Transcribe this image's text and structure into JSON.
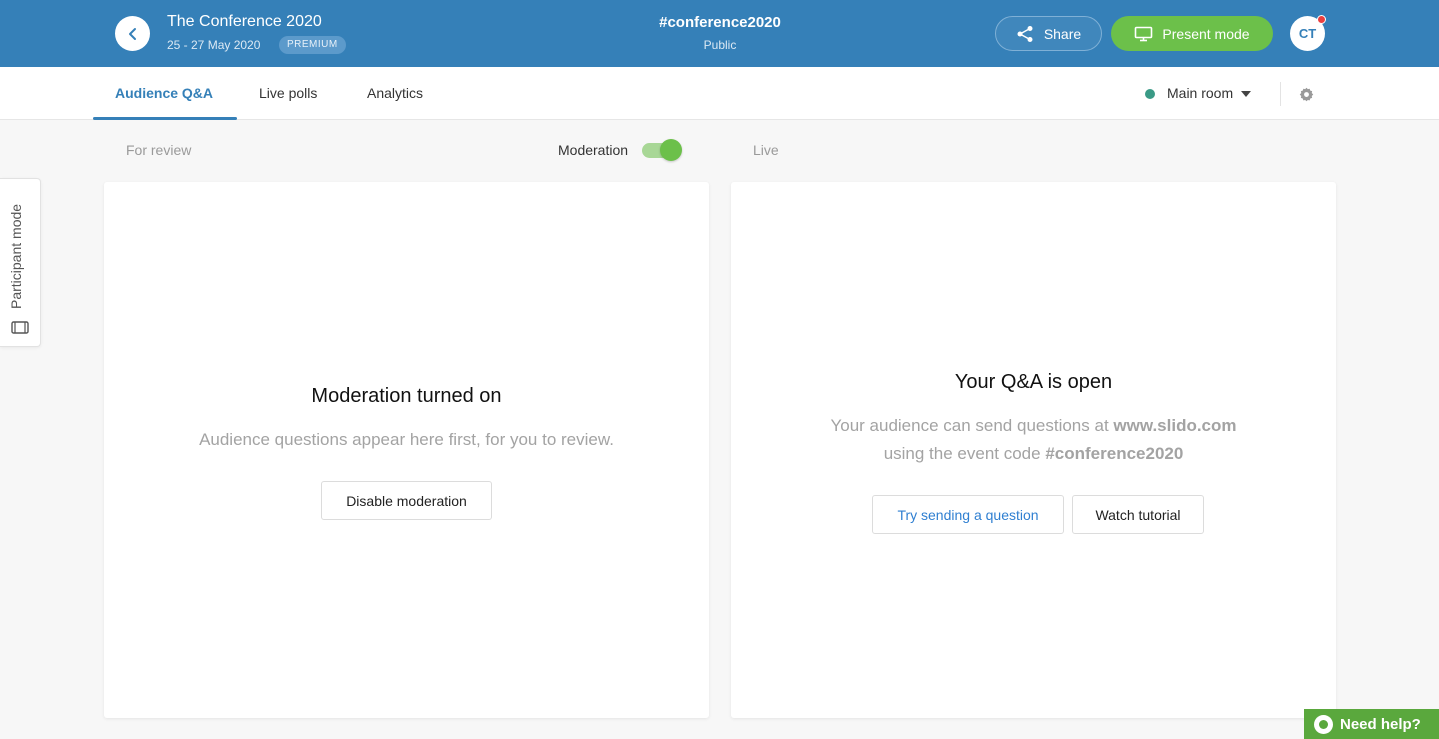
{
  "header": {
    "event_title": "The Conference 2020",
    "event_dates": "25 - 27 May 2020",
    "badge": "PREMIUM",
    "event_code": "#conference2020",
    "privacy": "Public",
    "share_label": "Share",
    "present_label": "Present mode",
    "avatar_initials": "CT",
    "colors": {
      "bar": "#3580b8",
      "present": "#6cc04a"
    },
    "icons": [
      "chevron-left-icon",
      "share-icon",
      "presentation-icon",
      "notification-dot"
    ]
  },
  "tabs": {
    "items": [
      {
        "label": "Audience Q&A",
        "active": true
      },
      {
        "label": "Live polls",
        "active": false
      },
      {
        "label": "Analytics",
        "active": false
      }
    ],
    "room_label": "Main room",
    "room_status_color": "#3a9a86",
    "icons": [
      "caret-down-icon",
      "gear-icon"
    ]
  },
  "columns": {
    "for_review": "For review",
    "moderation": "Moderation",
    "moderation_on": true,
    "live": "Live"
  },
  "left_card": {
    "title": "Moderation turned on",
    "text": "Audience questions appear here first, for you to review.",
    "button": "Disable moderation"
  },
  "right_card": {
    "title": "Your Q&A is open",
    "line1_prefix": "Your audience can send questions at",
    "line1_bold": "www.slido.com",
    "line2_prefix": "using the event code",
    "line2_bold": "#conference2020",
    "try_button": "Try sending a question",
    "tutorial_button": "Watch tutorial"
  },
  "side_tab": {
    "label": "Participant mode",
    "icon": "screen-icon"
  },
  "help": {
    "label": "Need help?",
    "icon": "chat-bubble-icon",
    "color": "#5aa83d"
  }
}
